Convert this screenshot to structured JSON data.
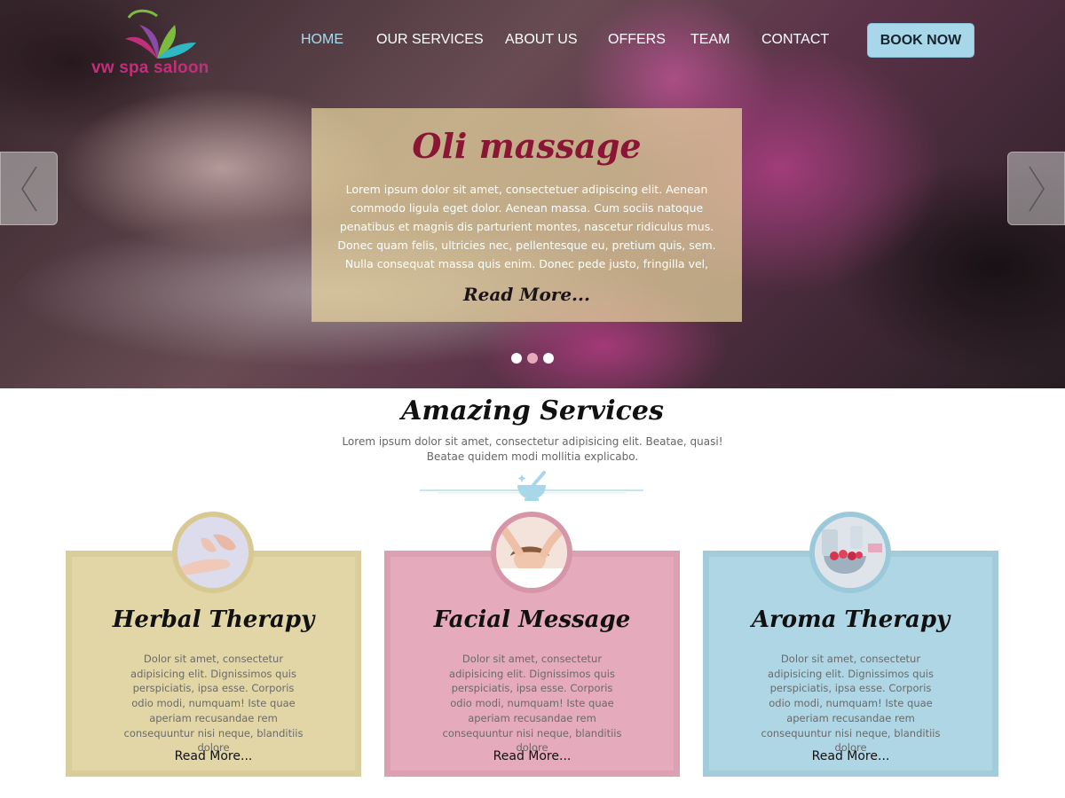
{
  "brand": {
    "name": "vw spa saloon"
  },
  "nav": {
    "items": [
      {
        "label": "HOME",
        "active": true
      },
      {
        "label": "OUR SERVICES",
        "active": false
      },
      {
        "label": "ABOUT US",
        "active": false
      },
      {
        "label": "OFFERS",
        "active": false
      },
      {
        "label": "TEAM",
        "active": false
      },
      {
        "label": "CONTACT",
        "active": false
      }
    ],
    "cta": "BOOK NOW"
  },
  "slider": {
    "title": "Oli  massage",
    "text": "Lorem ipsum dolor sit amet, consectetuer adipiscing elit. Aenean commodo ligula eget dolor. Aenean massa. Cum sociis natoque penatibus et magnis dis parturient montes, nascetur ridiculus mus. Donec quam felis, ultricies nec, pellentesque eu, pretium quis, sem. Nulla consequat massa quis enim. Donec pede justo, fringilla vel,",
    "read_more": "Read More...",
    "dots": 3,
    "active_dot": 2
  },
  "services": {
    "title": "Amazing Services",
    "subtitle_line1": "Lorem ipsum dolor sit amet, consectetur adipisicing elit. Beatae, quasi!",
    "subtitle_line2": "Beatae quidem modi mollitia explicabo.",
    "cards": [
      {
        "title": "Herbal  Therapy",
        "text": "Dolor sit amet, consectetur adipisicing elit. Dignissimos quis perspiciatis, ipsa esse. Corporis odio modi, numquam! Iste quae aperiam recusandae rem consequuntur nisi neque, blanditiis dolore",
        "read_more": "Read More...",
        "color": "#e2d6a6",
        "border": "#dacd9c",
        "icon": "foot-massage-icon"
      },
      {
        "title": "Facial Message",
        "text": "Dolor sit amet, consectetur adipisicing elit. Dignissimos quis perspiciatis, ipsa esse. Corporis odio modi, numquam! Iste quae aperiam recusandae rem consequuntur nisi neque, blanditiis dolore",
        "read_more": "Read More...",
        "color": "#e5aabb",
        "border": "#dba1b2",
        "icon": "facial-treatment-icon"
      },
      {
        "title": "Aroma Therapy",
        "text": "Dolor sit amet, consectetur adipisicing elit. Dignissimos quis perspiciatis, ipsa esse. Corporis odio modi, numquam! Iste quae aperiam recusandae rem consequuntur nisi neque, blanditiis dolore",
        "read_more": "Read More...",
        "color": "#aed6e4",
        "border": "#a3ccdb",
        "icon": "aroma-bowl-icon"
      }
    ]
  },
  "colors": {
    "accent": "#a9d7ea",
    "brand": "#c0307a",
    "slide_title": "#8a1535"
  }
}
